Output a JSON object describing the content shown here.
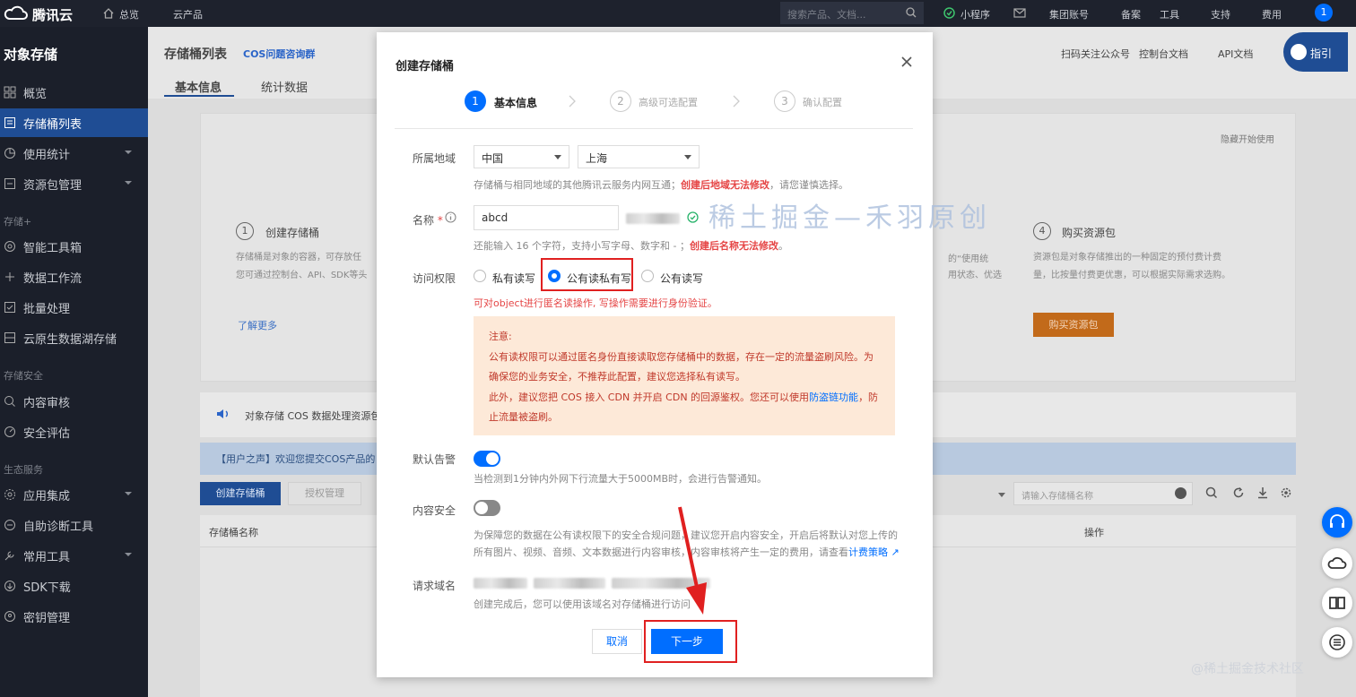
{
  "topbar": {
    "logo": "腾讯云",
    "home": "总览",
    "products": "云产品",
    "search_placeholder": "搜索产品、文档...",
    "items": [
      "小程序",
      "集团账号",
      "备案",
      "工具",
      "支持",
      "费用"
    ],
    "avatar": "1"
  },
  "sidebar": {
    "title": "对象存储",
    "items": [
      "概览",
      "存储桶列表",
      "使用统计",
      "资源包管理"
    ],
    "group2": "存储+",
    "items2": [
      "智能工具箱",
      "数据工作流",
      "批量处理",
      "云原生数据湖存储"
    ],
    "group3": "存储安全",
    "items3": [
      "内容审核",
      "安全评估"
    ],
    "group4": "生态服务",
    "items4": [
      "应用集成",
      "自助诊断工具",
      "常用工具",
      "SDK下载",
      "密钥管理"
    ]
  },
  "page": {
    "title": "存储桶列表",
    "community_link": "COS问题咨询群",
    "tabs": [
      "基本信息",
      "统计数据"
    ],
    "header_links": [
      "扫码关注公众号",
      "控制台文档",
      "API文档"
    ],
    "guide_button": "指引",
    "hide_guide": "隐藏开始使用",
    "card1_num": "1",
    "card1_title": "创建存储桶",
    "card1_desc1": "存储桶是对象的容器，可存放任",
    "card1_desc2": "您可通过控制台、API、SDK等头",
    "learn_more": "了解更多",
    "card4_num": "4",
    "card4_title": "购买资源包",
    "card4_desc1": "资源包是对象存储推出的一种固定的预付费计费",
    "card4_desc2": "量，比按量付费更优惠，可以根据实际需求选购。",
    "card4_button": "购买资源包",
    "card_right_text1": "的“使用统",
    "card_right_text2": "用状态、优选",
    "notice": "对象存储 COS 数据处理资源包",
    "user_voice": "【用户之声】欢迎您提交COS产品的",
    "create_button": "创建存储桶",
    "second_button": "授权管理",
    "bucket_search_placeholder": "请输入存储桶名称",
    "col_name": "存储桶名称",
    "col_ops": "操作"
  },
  "modal": {
    "title": "创建存储桶",
    "steps": [
      {
        "num": "1",
        "label": "基本信息"
      },
      {
        "num": "2",
        "label": "高级可选配置"
      },
      {
        "num": "3",
        "label": "确认配置"
      }
    ],
    "region_label": "所属地域",
    "region_country": "中国",
    "region_city": "上海",
    "region_hint": "存储桶与相同地域的其他腾讯云服务内网互通；",
    "region_hint_red": "创建后地域无法修改",
    "region_hint_end": "，请您谨慎选择。",
    "name_label": "名称",
    "name_value": "abcd",
    "name_hint": "还能输入 16 个字符，支持小写字母、数字和 - ；",
    "name_hint_red": "创建后名称无法修改",
    "name_hint_end": "。",
    "access_label": "访问权限",
    "access_options": [
      "私有读写",
      "公有读私有写",
      "公有读写"
    ],
    "access_warning": "可对object进行匿名读操作, 写操作需要进行身份验证。",
    "note_title": "注意:",
    "note_line1": "公有读权限可以通过匿名身份直接读取您存储桶中的数据，存在一定的流量盗刷风险。为",
    "note_line2": "确保您的业务安全，不推荐此配置，建议您选择私有读写。",
    "note_line3": "此外，建议您把 COS 接入 CDN 并开启 CDN 的回源鉴权。您还可以使用",
    "note_link": "防盗链功能",
    "note_line3_end": "，防",
    "note_line4": "止流量被盗刷。",
    "alarm_label": "默认告警",
    "alarm_hint": "当检测到1分钟内外网下行流量大于5000MB时，会进行告警通知。",
    "content_label": "内容安全",
    "content_hint1": "为保障您的数据在公有读权限下的安全合规问题，建议您开启内容安全，开启后将默认对您上传的",
    "content_hint2": "所有图片、视频、音频、文本数据进行内容审核，内容审核将产生一定的费用，请查看",
    "content_link": "计费策略",
    "domain_label": "请求域名",
    "domain_hint": "创建完成后，您可以使用该域名对存储桶进行访问",
    "cancel": "取消",
    "next": "下一步"
  },
  "watermark": "稀土掘金—禾羽原创",
  "footer_watermark": "@稀土掘金技术社区",
  "colors": {
    "primary": "#006eff",
    "danger": "#e54545",
    "annotation": "#e02020",
    "note_bg": "#fde9d8"
  }
}
